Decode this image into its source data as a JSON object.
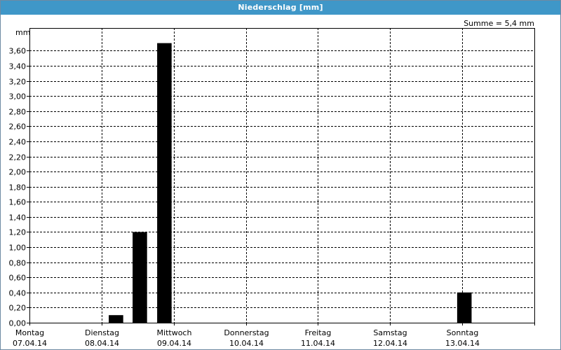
{
  "window": {
    "title": "Niederschlag [mm]"
  },
  "summary": "Summe = 5,4 mm",
  "colors": {
    "titlebar": "#3f97c8",
    "bar": "#000000",
    "grid": "#000000"
  },
  "chart_data": {
    "type": "bar",
    "title": "Niederschlag [mm]",
    "ylabel": "mm",
    "ylim": [
      0,
      3.9
    ],
    "grid": true,
    "y_ticks": [
      "0,00",
      "0,20",
      "0,40",
      "0,60",
      "0,80",
      "1,00",
      "1,20",
      "1,40",
      "1,60",
      "1,80",
      "2,00",
      "2,20",
      "2,40",
      "2,60",
      "2,80",
      "3,00",
      "3,20",
      "3,40",
      "3,60"
    ],
    "x_labels": [
      {
        "day": "Montag",
        "date": "07.04.14"
      },
      {
        "day": "Dienstag",
        "date": "08.04.14"
      },
      {
        "day": "Mittwoch",
        "date": "09.04.14"
      },
      {
        "day": "Donnerstag",
        "date": "10.04.14"
      },
      {
        "day": "Freitag",
        "date": "11.04.14"
      },
      {
        "day": "Samstag",
        "date": "12.04.14"
      },
      {
        "day": "Sonntag",
        "date": "13.04.14"
      }
    ],
    "x_range_days": [
      0,
      7
    ],
    "bars": [
      {
        "x": 1.1,
        "value": 0.1
      },
      {
        "x": 1.43,
        "value": 1.2
      },
      {
        "x": 1.77,
        "value": 3.7
      },
      {
        "x": 5.93,
        "value": 0.4
      }
    ],
    "bar_width_days": 0.2
  }
}
